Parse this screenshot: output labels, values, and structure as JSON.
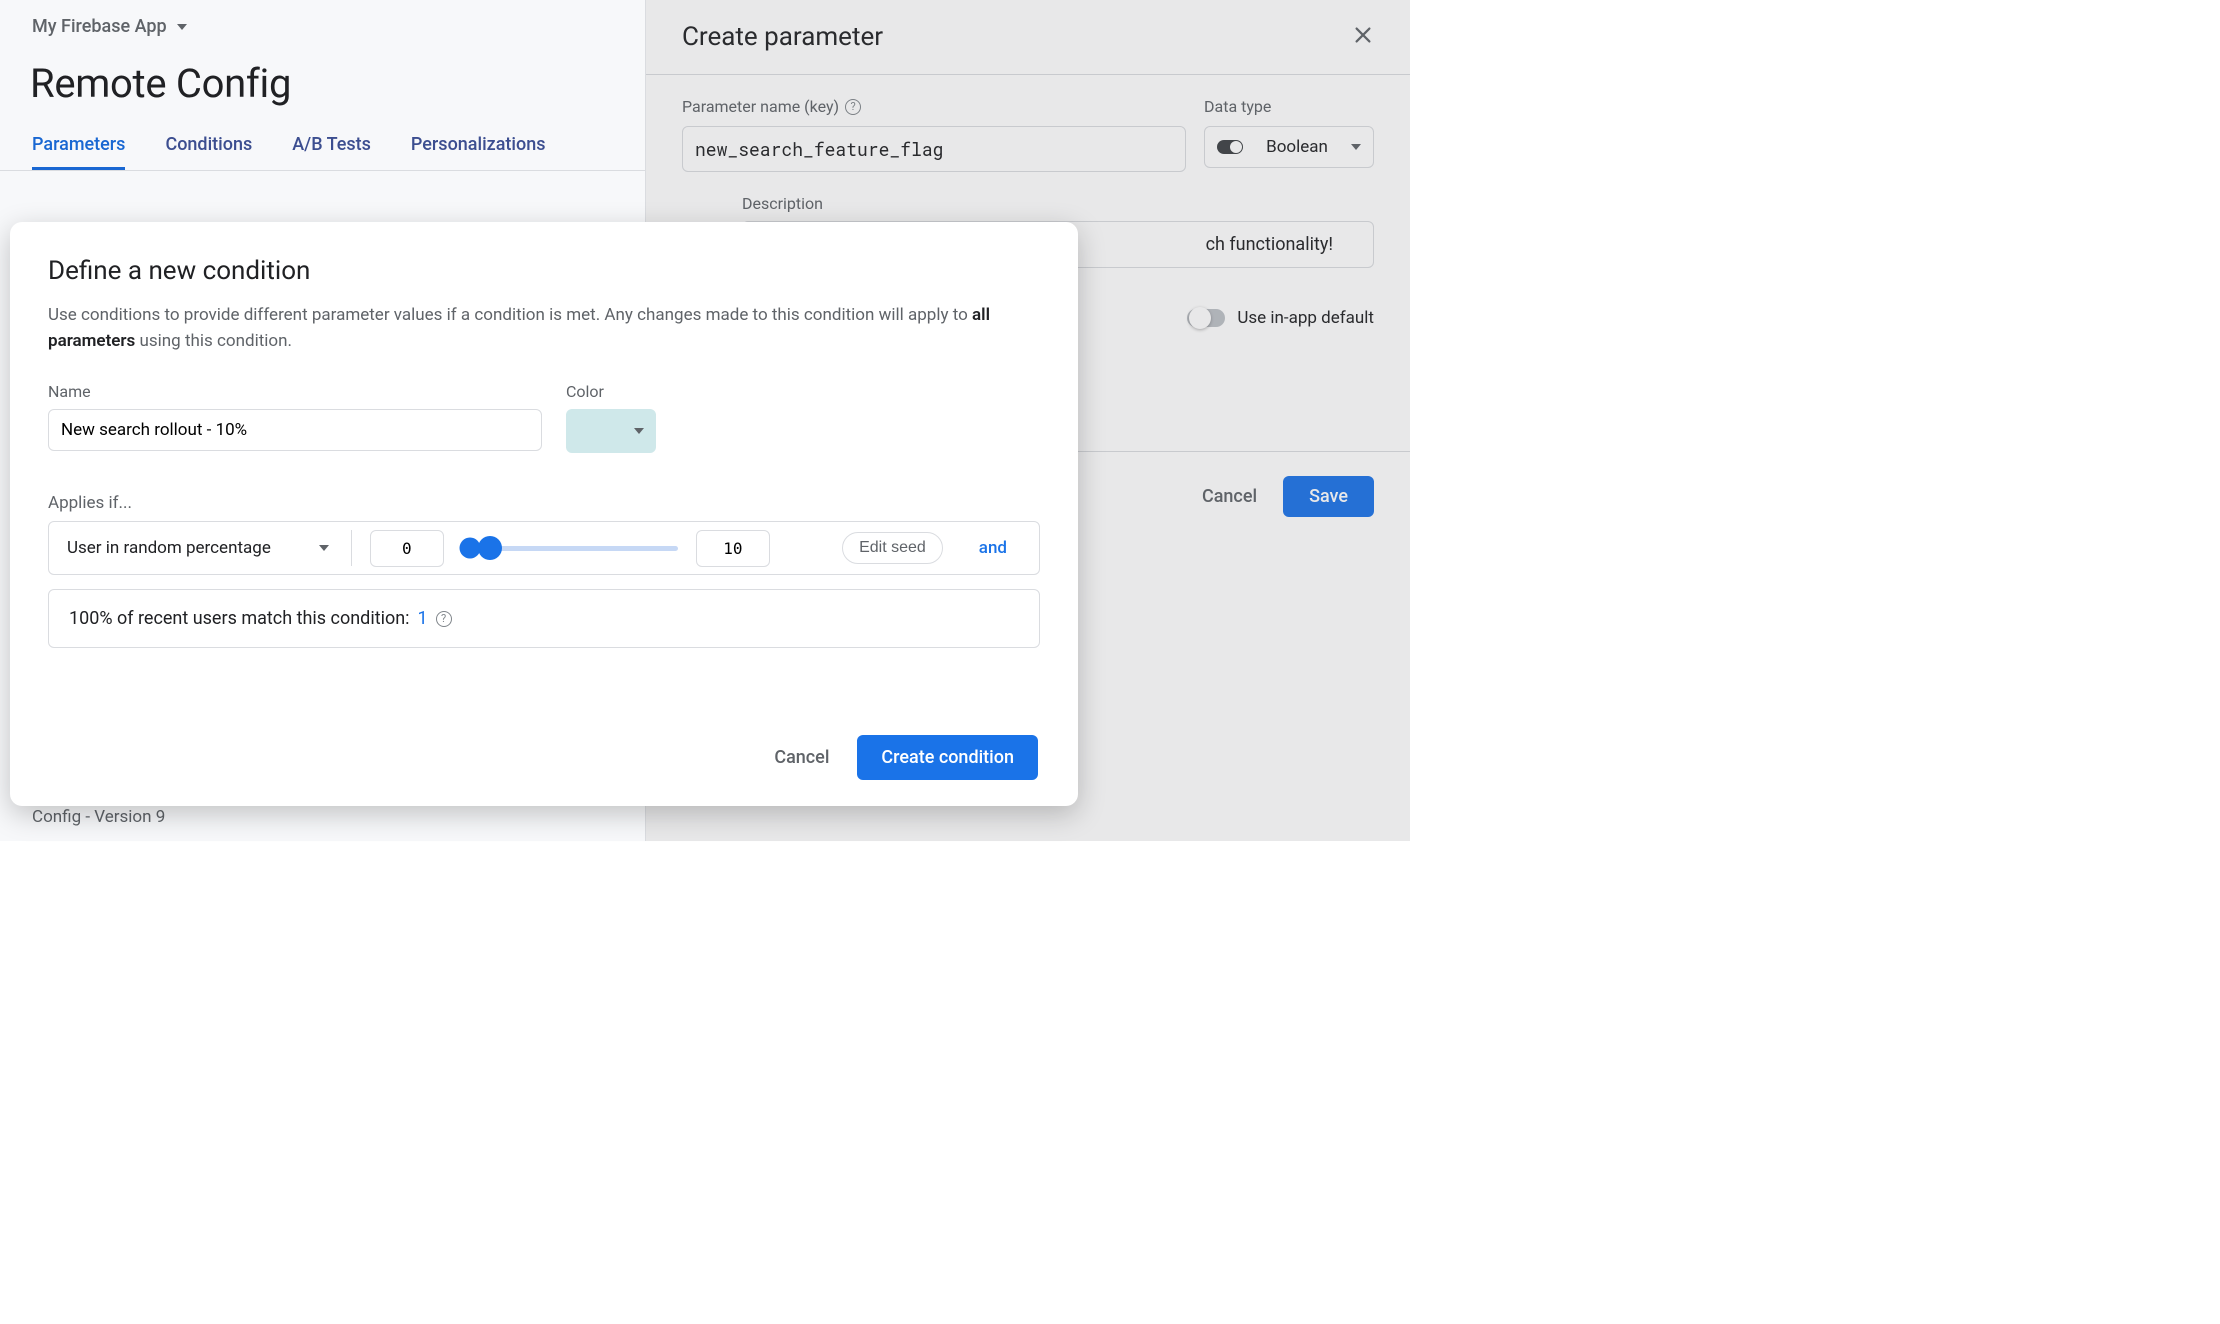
{
  "header": {
    "project_name": "My Firebase App",
    "page_title": "Remote Config"
  },
  "tabs": [
    {
      "label": "Parameters",
      "active": true
    },
    {
      "label": "Conditions",
      "active": false
    },
    {
      "label": "A/B Tests",
      "active": false
    },
    {
      "label": "Personalizations",
      "active": false
    }
  ],
  "version_label": "Config - Version 9",
  "side_panel": {
    "title": "Create parameter",
    "param_label": "Parameter name (key)",
    "param_value": "new_search_feature_flag",
    "data_type_label": "Data type",
    "data_type_value": "Boolean",
    "description_label": "Description",
    "description_value": "ch functionality!",
    "use_default_label": "Use in-app default",
    "use_default_on": false,
    "cancel_label": "Cancel",
    "save_label": "Save"
  },
  "modal": {
    "title": "Define a new condition",
    "subtext_pre": "Use conditions to provide different parameter values if a condition is met. Any changes made to this condition will apply to ",
    "subtext_bold": "all parameters",
    "subtext_post": " using this condition.",
    "name_label": "Name",
    "name_value": "New search rollout - 10%",
    "color_label": "Color",
    "color_value": "#cfe8ea",
    "applies_label": "Applies if...",
    "rule": {
      "type_label": "User in random percentage",
      "low": "0",
      "high": "10",
      "edit_seed_label": "Edit seed",
      "and_label": "and"
    },
    "match": {
      "text_pre": "100% of recent users match this condition: ",
      "count": "1"
    },
    "cancel_label": "Cancel",
    "create_label": "Create condition"
  }
}
